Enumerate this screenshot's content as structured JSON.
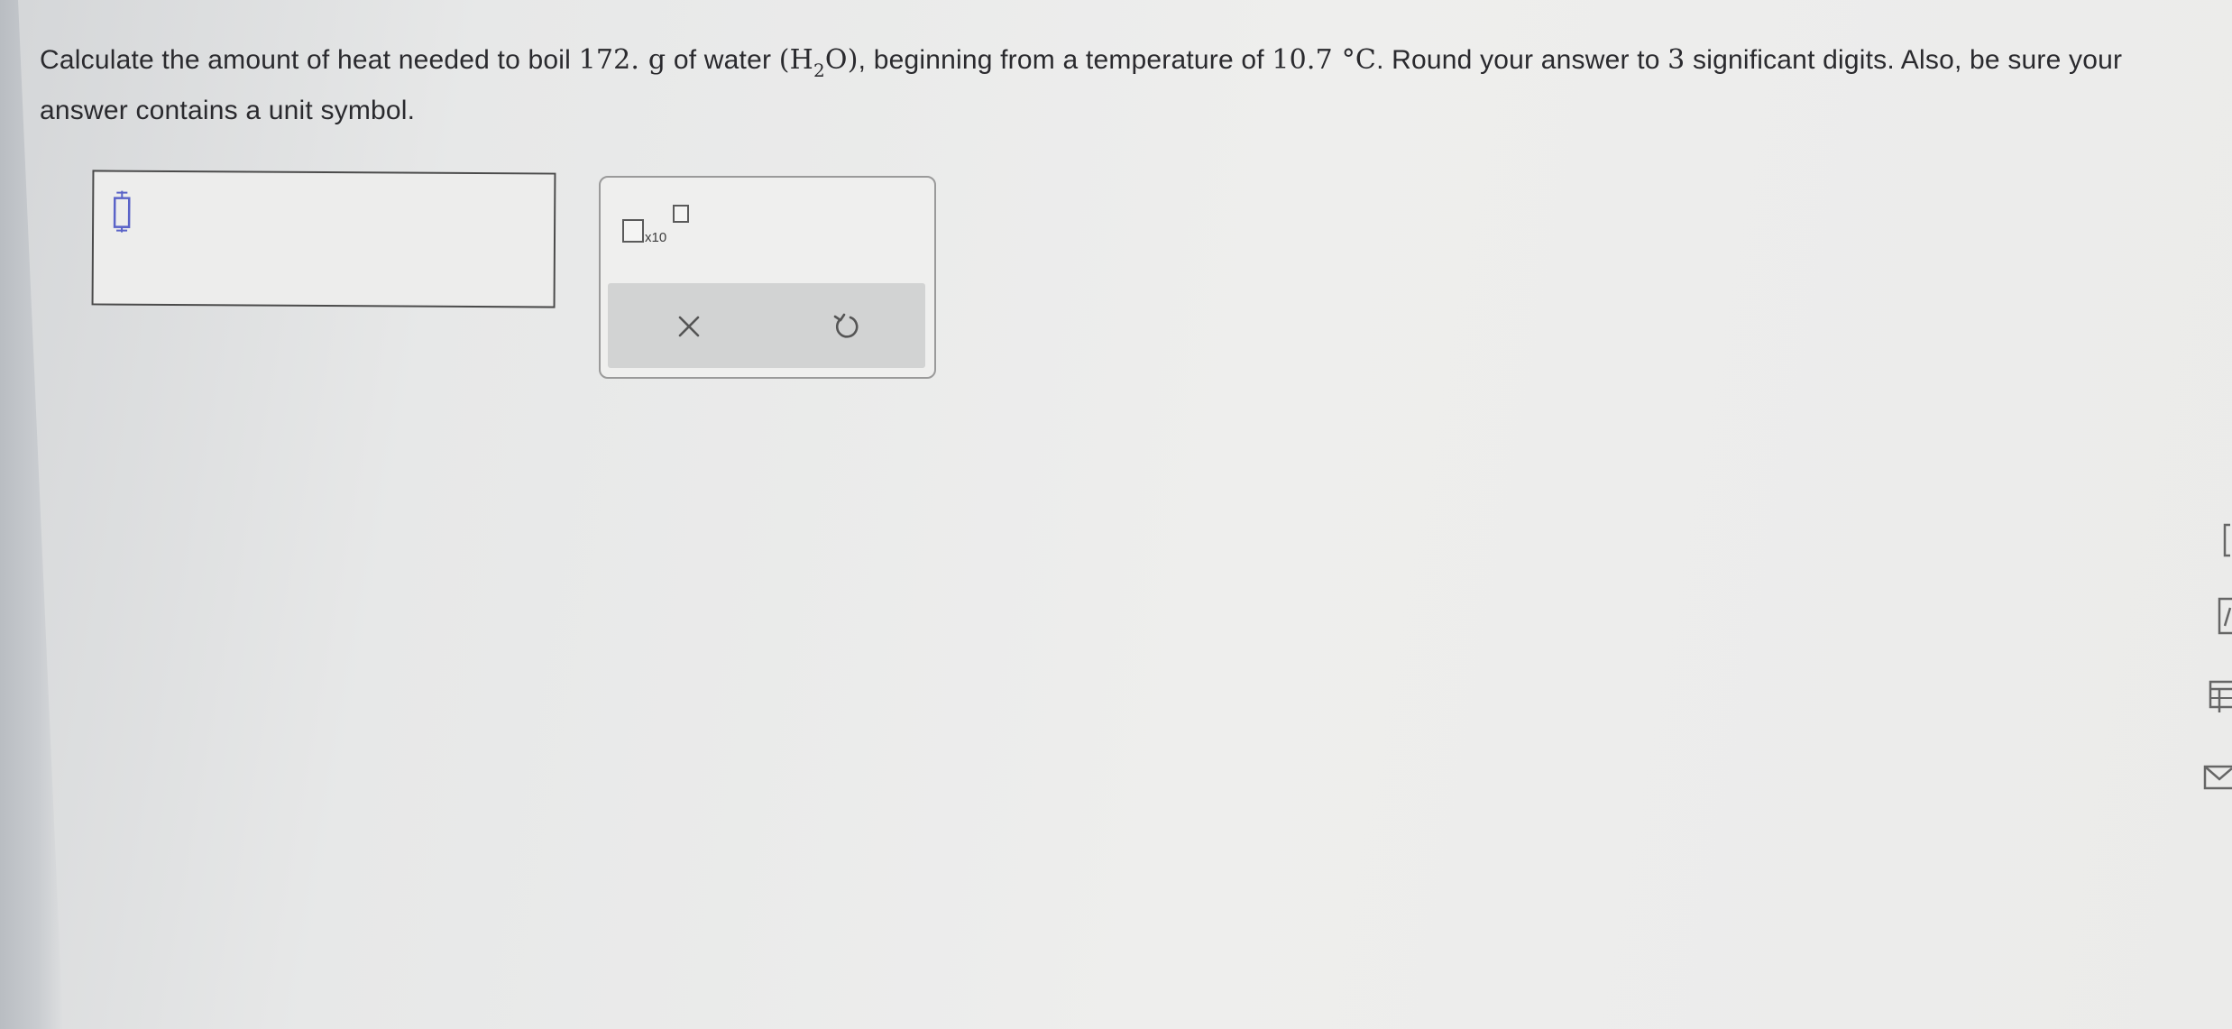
{
  "question": {
    "part1": "Calculate the amount of heat needed to boil ",
    "mass_value": "172.",
    "mass_unit": " g",
    "part2": " of water ",
    "formula_open": "(H",
    "formula_sub": "2",
    "formula_close": "O)",
    "part3": ", beginning from a temperature of ",
    "temp_value": "10.7",
    "temp_unit": " °C",
    "part4": ". Round your answer to ",
    "digits": "3",
    "part5": " significant digits. Also, be sure your answer contains a unit symbol."
  },
  "answer_input": {
    "value": ""
  },
  "tools": {
    "sci_notation_label": "x10",
    "clear_icon": "x-icon",
    "undo_icon": "undo-icon"
  },
  "colors": {
    "text": "#2a2a2e",
    "cursor": "#5a63c8",
    "border": "#4b4b4b",
    "action_bar": "#d2d3d3",
    "icon": "#555555"
  }
}
